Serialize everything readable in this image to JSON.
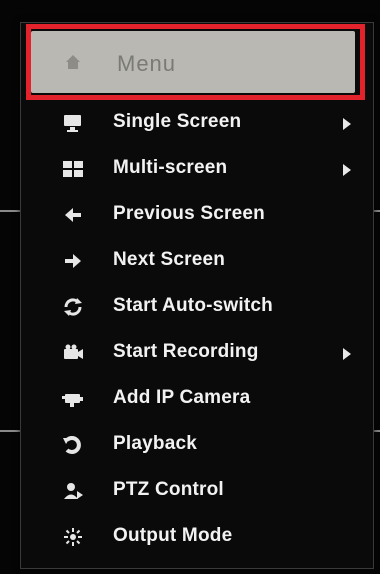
{
  "menu": {
    "header": {
      "label": "Menu",
      "icon": "home-icon"
    },
    "items": [
      {
        "label": "Single Screen",
        "icon": "single-screen-icon",
        "submenu": true
      },
      {
        "label": "Multi-screen",
        "icon": "multi-screen-icon",
        "submenu": true
      },
      {
        "label": "Previous Screen",
        "icon": "arrow-left-icon",
        "submenu": false
      },
      {
        "label": "Next Screen",
        "icon": "arrow-right-icon",
        "submenu": false
      },
      {
        "label": "Start Auto-switch",
        "icon": "auto-switch-icon",
        "submenu": false
      },
      {
        "label": "Start Recording",
        "icon": "recording-icon",
        "submenu": true
      },
      {
        "label": "Add IP Camera",
        "icon": "ip-camera-icon",
        "submenu": false
      },
      {
        "label": "Playback",
        "icon": "playback-icon",
        "submenu": false
      },
      {
        "label": "PTZ Control",
        "icon": "ptz-icon",
        "submenu": false
      },
      {
        "label": "Output Mode",
        "icon": "output-mode-icon",
        "submenu": false
      }
    ]
  },
  "colors": {
    "menu_background": "#0a0a0a",
    "header_background": "#b9b8b3",
    "highlight_border": "#e3232b",
    "text": "#f2f2f2"
  }
}
